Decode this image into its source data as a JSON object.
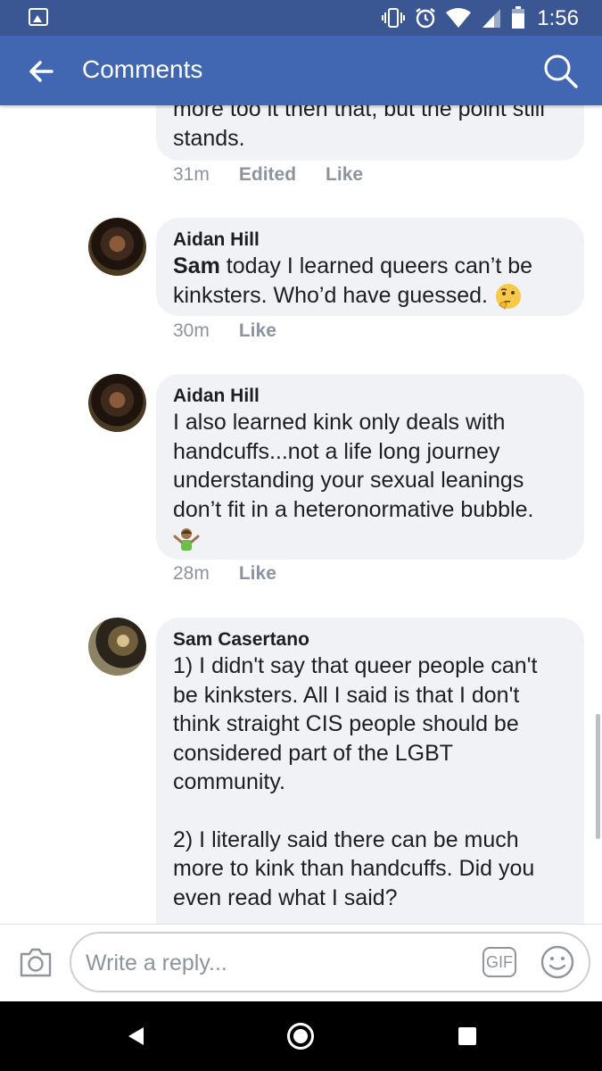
{
  "status_bar": {
    "time": "1:56",
    "icons": [
      "gallery-icon",
      "vibrate-icon",
      "alarm-icon",
      "wifi-icon",
      "signal-icon",
      "battery-icon"
    ]
  },
  "app_bar": {
    "title": "Comments",
    "back_icon": "back-arrow-icon",
    "search_icon": "search-icon",
    "color": "#4267b2"
  },
  "comments": [
    {
      "text": "more too it then that, but the point still stands.",
      "time": "31m",
      "edited": "Edited",
      "like": "Like"
    },
    {
      "author": "Aidan Hill",
      "mention": "Sam",
      "text": " today I learned queers can’t be kinksters. Who’d have guessed.",
      "emoji": "thinking-face-emoji",
      "time": "30m",
      "like": "Like"
    },
    {
      "author": "Aidan Hill",
      "text": "I also learned kink only deals with handcuffs...not a life long journey understanding your sexual leanings don’t fit in a heteronormative bubble.",
      "emoji": "person-shrugging-emoji",
      "time": "28m",
      "like": "Like"
    },
    {
      "author": "Sam Casertano",
      "paragraph1": "1) I didn't say that queer people can't be kinksters. All I said is that I don't think straight CIS people should be considered part of the LGBT community.",
      "paragraph2": "2) I literally said there can be much more to kink than handcuffs. Did you even read what I said?"
    }
  ],
  "reply_bar": {
    "placeholder": "Write a reply...",
    "gif_label": "GIF"
  }
}
